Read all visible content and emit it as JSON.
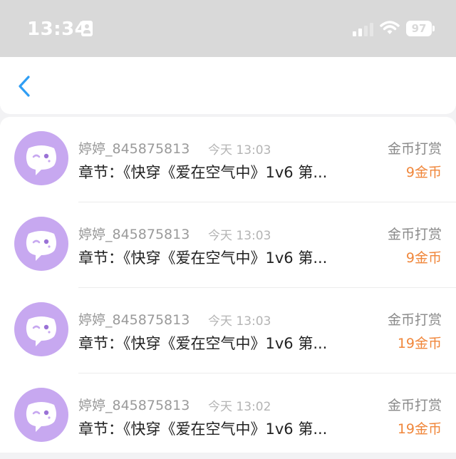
{
  "status_bar": {
    "time": "13:34",
    "battery": "97",
    "icons": [
      "id-card-icon",
      "cellular-signal-icon",
      "wifi-icon",
      "battery-icon"
    ]
  },
  "nav": {
    "back_icon": "chevron-left-icon",
    "accent_color": "#2f9ef4"
  },
  "colors": {
    "reward_amount": "#f0863a",
    "avatar_bg": "#c7a8f0",
    "status_bar_bg": "#d9d9d9"
  },
  "records": [
    {
      "user": "婷婷_845875813",
      "time": "今天 13:03",
      "chapter": "章节：《快穿《爱在空气中》1v6 第...",
      "type": "金币打赏",
      "amount": "9金币"
    },
    {
      "user": "婷婷_845875813",
      "time": "今天 13:03",
      "chapter": "章节：《快穿《爱在空气中》1v6 第...",
      "type": "金币打赏",
      "amount": "9金币"
    },
    {
      "user": "婷婷_845875813",
      "time": "今天 13:03",
      "chapter": "章节：《快穿《爱在空气中》1v6 第...",
      "type": "金币打赏",
      "amount": "19金币"
    },
    {
      "user": "婷婷_845875813",
      "time": "今天 13:02",
      "chapter": "章节：《快穿《爱在空气中》1v6 第...",
      "type": "金币打赏",
      "amount": "19金币"
    }
  ]
}
